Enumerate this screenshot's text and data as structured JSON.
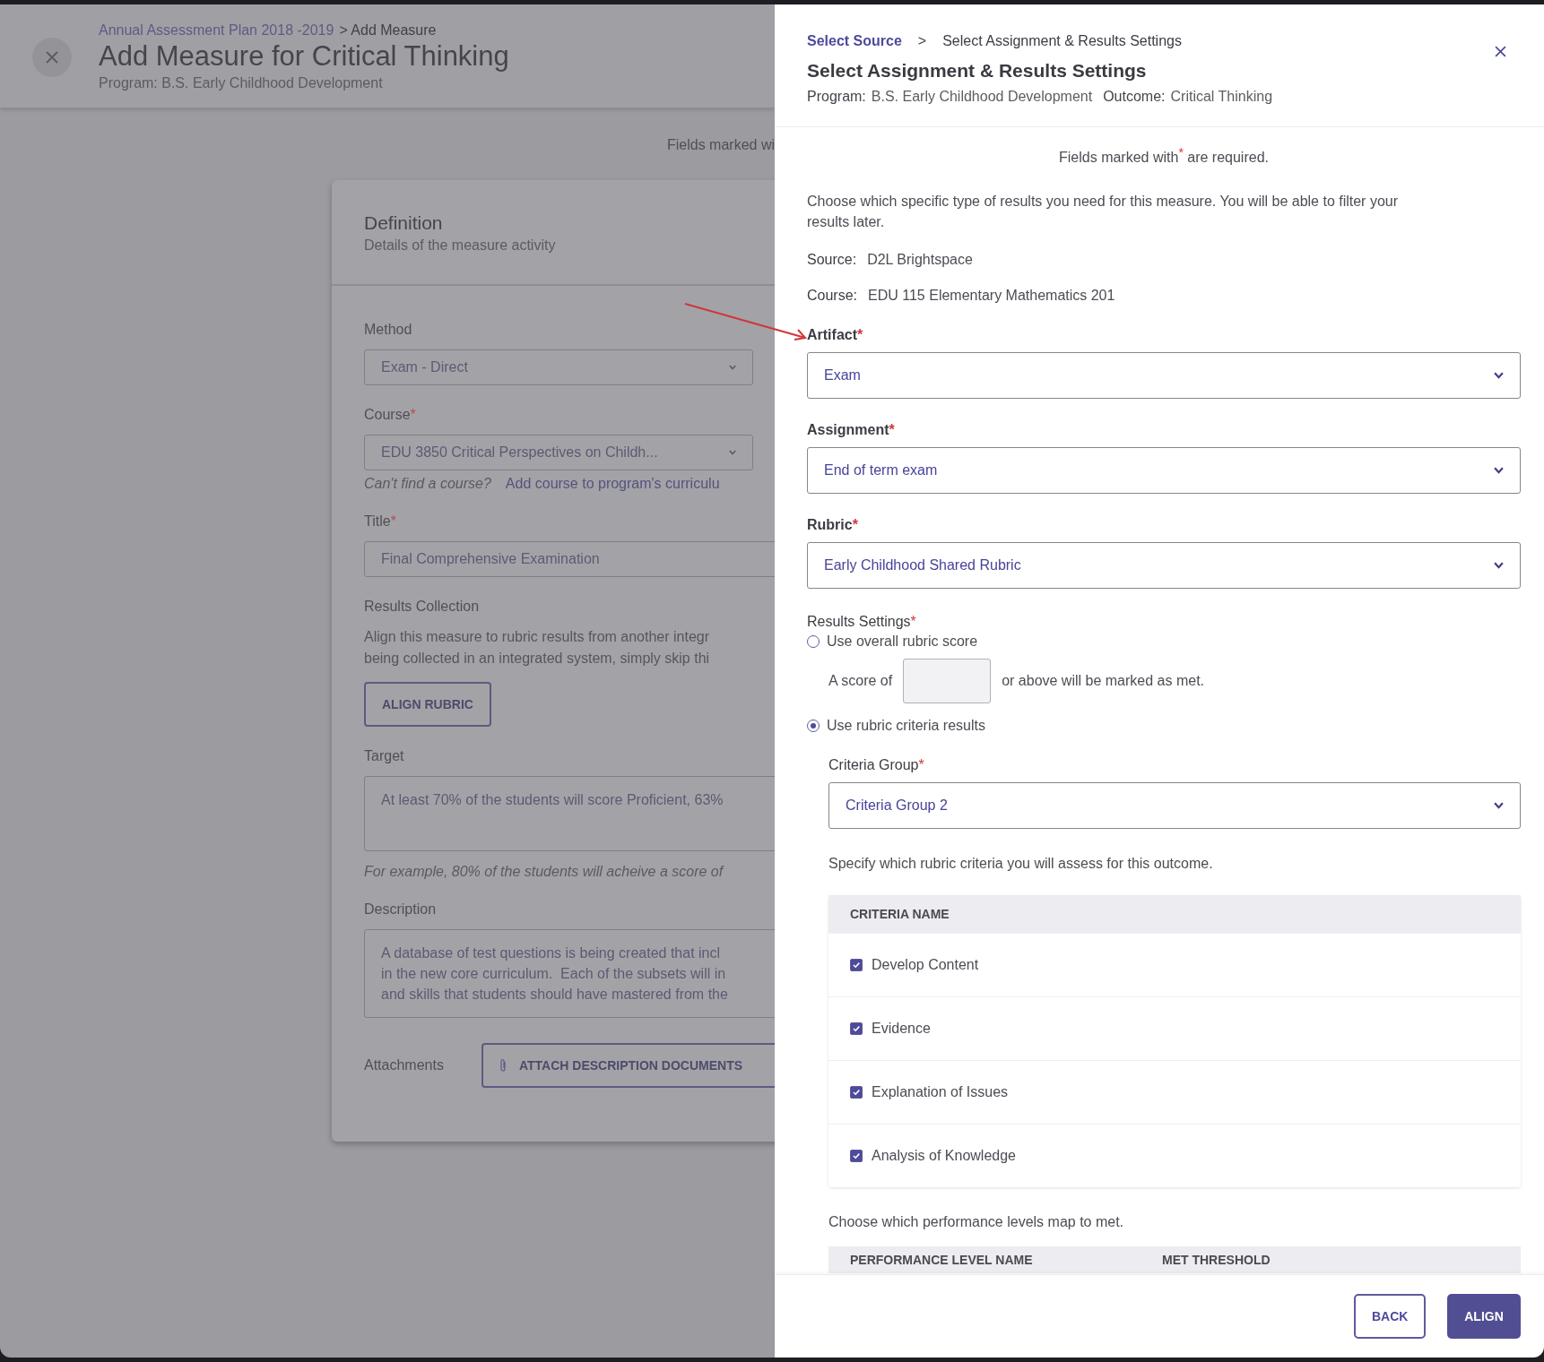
{
  "background_page": {
    "breadcrumb": {
      "link": "Annual Assessment Plan 2018 -2019",
      "current": "> Add Measure"
    },
    "title": "Add Measure for Critical Thinking",
    "program": "Program: B.S. Early Childhood Development",
    "required_note": "Fields marked wi",
    "card": {
      "title": "Definition",
      "subtitle": "Details of the measure activity",
      "fields": [
        {
          "kind": "select",
          "label": "Method",
          "value": "Exam - Direct"
        },
        {
          "kind": "select",
          "label": "Course",
          "mark": "*",
          "value": "EDU 3850 Critical Perspectives on Childh...",
          "hint": "Can't find a course?",
          "link": "Add course to program's curriculu"
        },
        {
          "kind": "text",
          "label": "Title",
          "mark": "*",
          "value": "Final Comprehensive Examination"
        },
        {
          "kind": "action",
          "label": "Results Collection",
          "lines": [
            "Align this measure to rubric results from another integr",
            "being collected in an integrated system, simply skip thi"
          ],
          "button": "ALIGN RUBRIC"
        },
        {
          "kind": "textarea",
          "label": "Target",
          "lines": [
            "At least 70% of the students will score Proficient, 63%"
          ],
          "hint": "For example, 80% of the students will acheive a score of"
        },
        {
          "kind": "textarea",
          "label": "Description",
          "lines": [
            "A database of test questions is being created that incl",
            "in the new core curriculum.  Each of the subsets will in",
            "and skills that students should have mastered from the"
          ]
        },
        {
          "kind": "attach",
          "label": "Attachments",
          "button": "ATTACH DESCRIPTION DOCUMENTS"
        }
      ]
    }
  },
  "panel": {
    "breadcrumb": [
      {
        "kind": "link",
        "label": "Select Source"
      },
      {
        "kind": "separator",
        "label": ">"
      },
      {
        "kind": "current",
        "label": "Select Assignment & Results Settings"
      }
    ],
    "title": "Select Assignment & Results Settings",
    "meta": [
      {
        "label": "Program:",
        "value": "B.S. Early Childhood Development"
      },
      {
        "label": "Outcome:",
        "value": "Critical Thinking"
      }
    ],
    "required_note": "Fields marked with$^{*}$ are required.",
    "intro": "Choose which specific type of results you need for this measure. You will be able to filter your results later.",
    "info": [
      {
        "label": "Source:",
        "value": "D2L Brightspace"
      },
      {
        "label": "Course:",
        "value": "EDU 115 Elementary Mathematics 201"
      }
    ],
    "selects": [
      {
        "label": "Artifact",
        "mark": "*",
        "value": "Exam"
      },
      {
        "label": "Assignment",
        "mark": "*",
        "value": "End of term exam"
      },
      {
        "label": "Rubric",
        "mark": "*",
        "value": "Early Childhood Shared Rubric"
      }
    ],
    "results_settings": {
      "label": "Results Settings",
      "mark": "*",
      "options": [
        {
          "label": "Use overall rubric score",
          "selected": false,
          "score_prefix": "A score of",
          "score_suffix": "or above will be marked as met."
        },
        {
          "label": "Use rubric criteria results",
          "selected": true
        }
      ]
    },
    "criteria_group": {
      "label": "Criteria Group",
      "mark": "*",
      "value": "Criteria Group 2"
    },
    "criteria_note": "Specify which rubric criteria you will assess for this outcome.",
    "criteria_table": {
      "columns": [
        "CRITERIA NAME"
      ],
      "rows": [
        {
          "name": "Develop Content",
          "checked": true
        },
        {
          "name": "Evidence",
          "checked": true
        },
        {
          "name": "Explanation of Issues",
          "checked": true
        },
        {
          "name": "Analysis of Knowledge",
          "checked": true
        }
      ]
    },
    "performance_note": "Choose which performance levels map to met.",
    "performance_table": {
      "columns": [
        "PERFORMANCE LEVEL NAME",
        "MET THRESHOLD"
      ]
    },
    "buttons": [
      {
        "kind": "secondary",
        "label": "BACK"
      },
      {
        "kind": "primary",
        "label": "ALIGN"
      }
    ]
  }
}
